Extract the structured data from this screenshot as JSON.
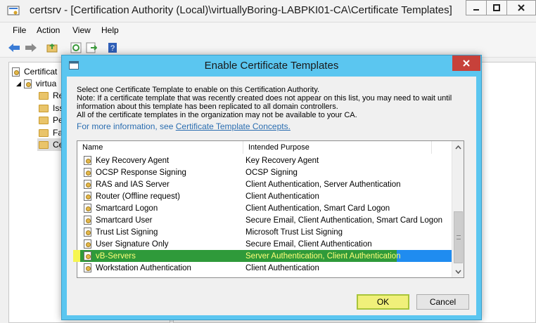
{
  "outer_window": {
    "title": "certsrv - [Certification Authority (Local)\\virtuallyBoring-LABPKI01-CA\\Certificate Templates]",
    "menu": [
      "File",
      "Action",
      "View",
      "Help"
    ],
    "tree": {
      "root": "Certificat",
      "ca": "virtua",
      "folders": [
        "Re",
        "Iss",
        "Pe",
        "Fa",
        "Ce"
      ]
    }
  },
  "dialog": {
    "title": "Enable Certificate Templates",
    "line1": "Select one Certificate Template to enable on this Certification Authority.",
    "line2": "Note: If a certificate template that was recently created does not appear on this list, you may need to wait until",
    "line3": "information about this template has been replicated to all domain controllers.",
    "line4": "All of the certificate templates in the organization may not be available to your CA.",
    "more_info_prefix": "For more information, see",
    "more_info_link": "Certificate Template Concepts.",
    "columns": {
      "name": "Name",
      "purpose": "Intended Purpose"
    },
    "rows": [
      {
        "name": "Key Recovery Agent",
        "purpose": "Key Recovery Agent"
      },
      {
        "name": "OCSP Response Signing",
        "purpose": "OCSP Signing"
      },
      {
        "name": "RAS and IAS Server",
        "purpose": "Client Authentication, Server Authentication"
      },
      {
        "name": "Router (Offline request)",
        "purpose": "Client Authentication"
      },
      {
        "name": "Smartcard Logon",
        "purpose": "Client Authentication, Smart Card Logon"
      },
      {
        "name": "Smartcard User",
        "purpose": "Secure Email, Client Authentication, Smart Card Logon"
      },
      {
        "name": "Trust List Signing",
        "purpose": "Microsoft Trust List Signing"
      },
      {
        "name": "User Signature Only",
        "purpose": "Secure Email, Client Authentication"
      },
      {
        "name": "vB-Servers",
        "purpose": "Server Authentication, Client Authentication"
      },
      {
        "name": "Workstation Authentication",
        "purpose": "Client Authentication"
      }
    ],
    "selected_row": "vB-Servers",
    "ok_label": "OK",
    "cancel_label": "Cancel"
  },
  "colors": {
    "dialog_frame": "#5bc6f0",
    "selection_bg": "#2f9a3a",
    "selection_text": "#ffff7a",
    "close_button": "#c7413a",
    "link": "#2a6db0"
  }
}
